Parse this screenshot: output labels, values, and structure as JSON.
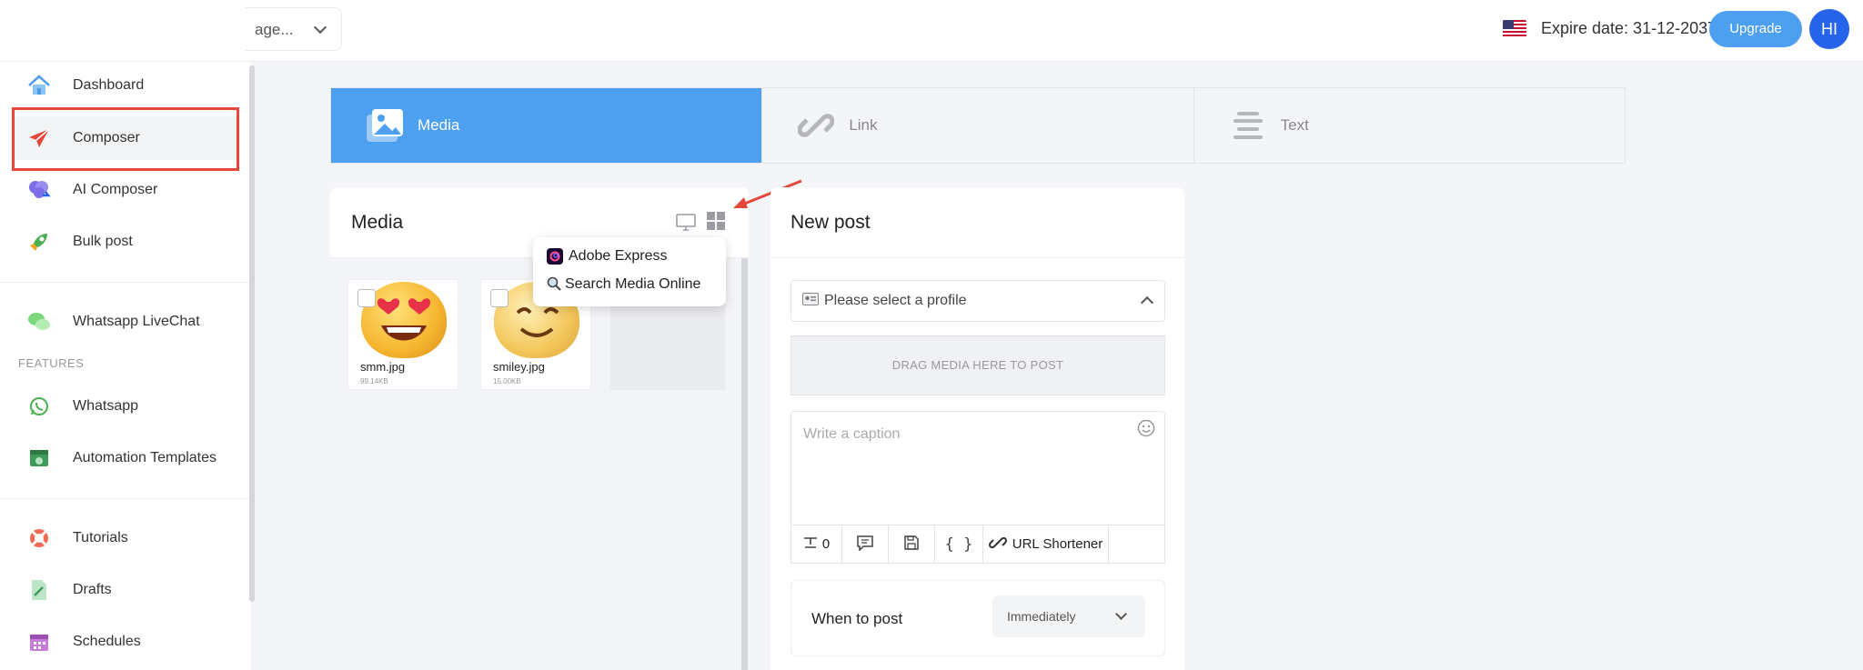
{
  "header": {
    "page_select_value": "age...",
    "expire_text": "Expire date: 31-12-2037",
    "upgrade_label": "Upgrade",
    "avatar_initials": "HI"
  },
  "sidebar": {
    "items": [
      {
        "label": "Dashboard",
        "icon": "home-icon"
      },
      {
        "label": "Composer",
        "icon": "paper-plane-icon"
      },
      {
        "label": "AI Composer",
        "icon": "brain-icon"
      },
      {
        "label": "Bulk post",
        "icon": "rocket-icon"
      },
      {
        "label": "Whatsapp LiveChat",
        "icon": "chat-bubbles-icon"
      },
      {
        "label": "Whatsapp",
        "icon": "whatsapp-icon"
      },
      {
        "label": "Automation Templates",
        "icon": "template-icon"
      },
      {
        "label": "Tutorials",
        "icon": "lifebuoy-icon"
      },
      {
        "label": "Drafts",
        "icon": "draft-file-icon"
      },
      {
        "label": "Schedules",
        "icon": "calendar-icon"
      }
    ],
    "section_features": "FEATURES",
    "active": "Composer"
  },
  "tabs": [
    {
      "label": "Media",
      "active": true
    },
    {
      "label": "Link",
      "active": false
    },
    {
      "label": "Text",
      "active": false
    }
  ],
  "media": {
    "title": "Media",
    "files": [
      {
        "name": "smm.jpg",
        "size": "99.14KB"
      },
      {
        "name": "smiley.jpg",
        "size": "15.00KB"
      }
    ],
    "menu": [
      {
        "label": "Adobe Express",
        "icon": "adobe-express-icon"
      },
      {
        "label": "Search Media Online",
        "icon": "search-icon"
      }
    ]
  },
  "post": {
    "title": "New post",
    "profile_placeholder": "Please select a profile",
    "dropzone_text": "DRAG MEDIA HERE TO POST",
    "caption_placeholder": "Write a caption",
    "char_count": "0",
    "url_shortener_label": "URL Shortener",
    "when_label": "When to post",
    "when_value": "Immediately"
  },
  "colors": {
    "accent": "#4d9ff0",
    "annotation": "#e5483a",
    "avatar": "#2563eb"
  }
}
